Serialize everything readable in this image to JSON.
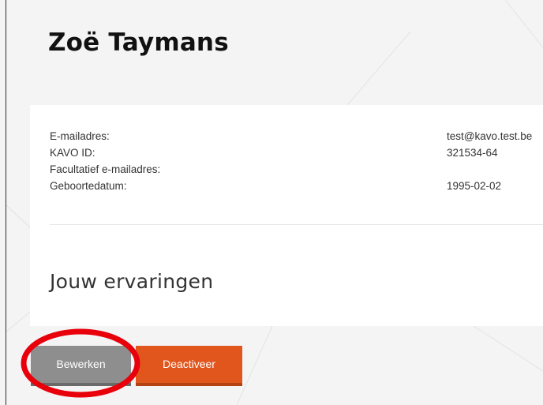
{
  "profile": {
    "name": "Zoë Taymans",
    "fields": [
      {
        "label": "E-mailadres:",
        "value": "test@kavo.test.be"
      },
      {
        "label": "KAVO ID:",
        "value": "321534-64"
      },
      {
        "label": "Facultatief e-mailadres:",
        "value": ""
      },
      {
        "label": "Geboortedatum:",
        "value": "1995-02-02"
      }
    ]
  },
  "experience": {
    "title": "Jouw ervaringen"
  },
  "actions": {
    "edit_label": "Bewerken",
    "deactivate_label": "Deactiveer"
  },
  "colors": {
    "edit_button": "#8e8e8e",
    "deactivate_button": "#e0561d",
    "highlight": "#e8000b"
  }
}
